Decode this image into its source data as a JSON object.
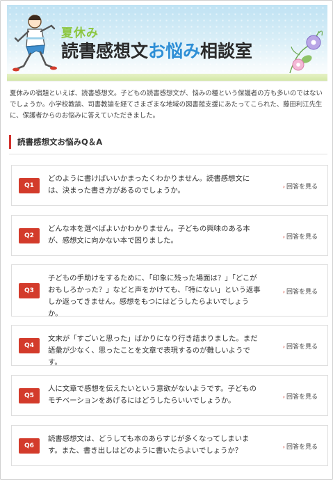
{
  "banner": {
    "label_summer": "夏休み",
    "title_part1": "読書感想文",
    "title_part2": "お悩み",
    "title_part3": "相談室"
  },
  "intro": "夏休みの宿題といえば、読書感想文。子どもの読書感想文が、悩みの種という保護者の方も多いのではないでしょうか。小学校教諭、司書教諭を経てさまざまな地域の図書館支援にあたってこられた、藤田利江先生に、保護者からのお悩みに答えていただきました。",
  "section_heading": "読書感想文お悩みQ＆A",
  "questions": [
    {
      "badge": "Q1",
      "text": "どのように書けばいいかまったくわかりません。読書感想文には、決まった書き方があるのでしょうか。",
      "link": "回答を見る"
    },
    {
      "badge": "Q2",
      "text": "どんな本を選べばよいかわかりません。子どもの興味のある本が、感想文に向かない本で困りました。",
      "link": "回答を見る"
    },
    {
      "badge": "Q3",
      "text": "子どもの手助けをするために、「印象に残った場面は？」「どこがおもしろかった？」などと声をかけても、「特にない」という返事しか返ってきません。感想をもつにはどうしたらよいでしょうか。",
      "link": "回答を見る"
    },
    {
      "badge": "Q4",
      "text": "文末が「すごいと思った」ばかりになり行き詰まりました。まだ語彙が少なく、思ったことを文章で表現するのが難しいようです。",
      "link": "回答を見る"
    },
    {
      "badge": "Q5",
      "text": "人に文章で感想を伝えたいという意欲がないようです。子どものモチベーションをあげるにはどうしたらいいでしょうか。",
      "link": "回答を見る"
    },
    {
      "badge": "Q6",
      "text": "読書感想文は、どうしても本のあらすじが多くなってしまいます。また、書き出しはどのように書いたらよいでしょうか？",
      "link": "回答を見る"
    }
  ],
  "colors": {
    "accent_red": "#d33b2b",
    "title_blue": "#2e8fd6",
    "summer_green": "#8cc63f"
  }
}
